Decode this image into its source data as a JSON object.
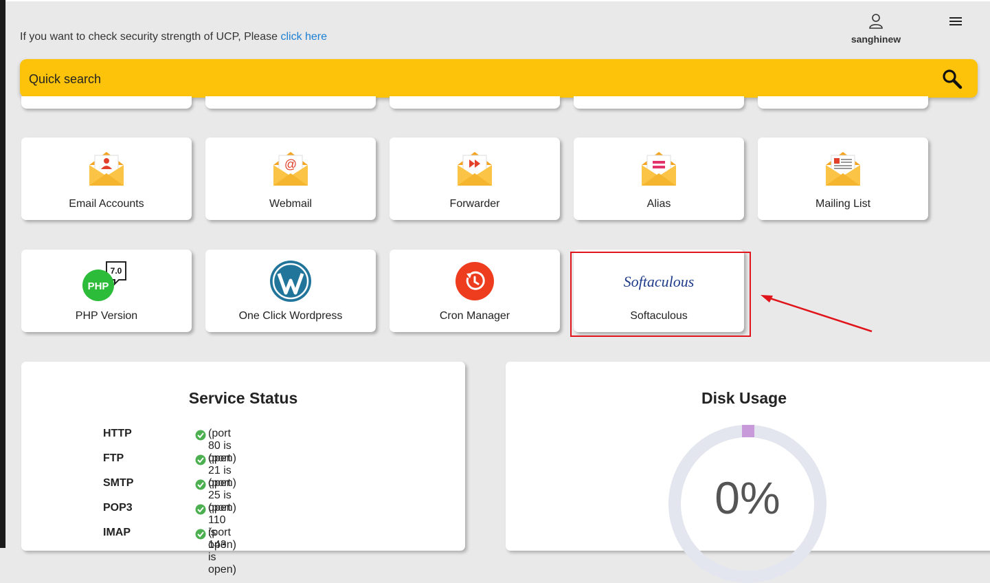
{
  "header": {
    "notice_text": "If you want to check security strength of UCP, Please ",
    "notice_link": "click here",
    "username": "sanghinew"
  },
  "search": {
    "placeholder": "Quick search"
  },
  "tiles_row1": [
    {
      "label": "Email Accounts",
      "icon": "email-accounts-icon"
    },
    {
      "label": "Webmail",
      "icon": "webmail-icon"
    },
    {
      "label": "Forwarder",
      "icon": "forwarder-icon"
    },
    {
      "label": "Alias",
      "icon": "alias-icon"
    },
    {
      "label": "Mailing List",
      "icon": "mailing-list-icon"
    }
  ],
  "tiles_row2": [
    {
      "label": "PHP Version",
      "icon": "php-icon",
      "badge": "7.0",
      "php_text": "PHP"
    },
    {
      "label": "One Click Wordpress",
      "icon": "wordpress-icon"
    },
    {
      "label": "Cron Manager",
      "icon": "cron-icon"
    },
    {
      "label": "Softaculous",
      "icon": "softaculous-logo",
      "logo_text": "Softaculous"
    }
  ],
  "service_status": {
    "title": "Service Status",
    "services": [
      {
        "name": "HTTP",
        "status": "(port 80 is open)"
      },
      {
        "name": "FTP",
        "status": "(port 21 is open)"
      },
      {
        "name": "SMTP",
        "status": "(port 25 is open)"
      },
      {
        "name": "POP3",
        "status": "(port 110 is open)"
      },
      {
        "name": "IMAP",
        "status": "(port 143 is open)"
      }
    ]
  },
  "disk_usage": {
    "title": "Disk Usage",
    "percent_label": "0%",
    "percent_value": 0
  },
  "colors": {
    "accent": "#fcc30a",
    "link": "#1a7fd4",
    "highlight": "#e0151b",
    "ok": "#4caf50",
    "donut_track": "#e3e6ee",
    "donut_marker": "#c99ad9"
  }
}
